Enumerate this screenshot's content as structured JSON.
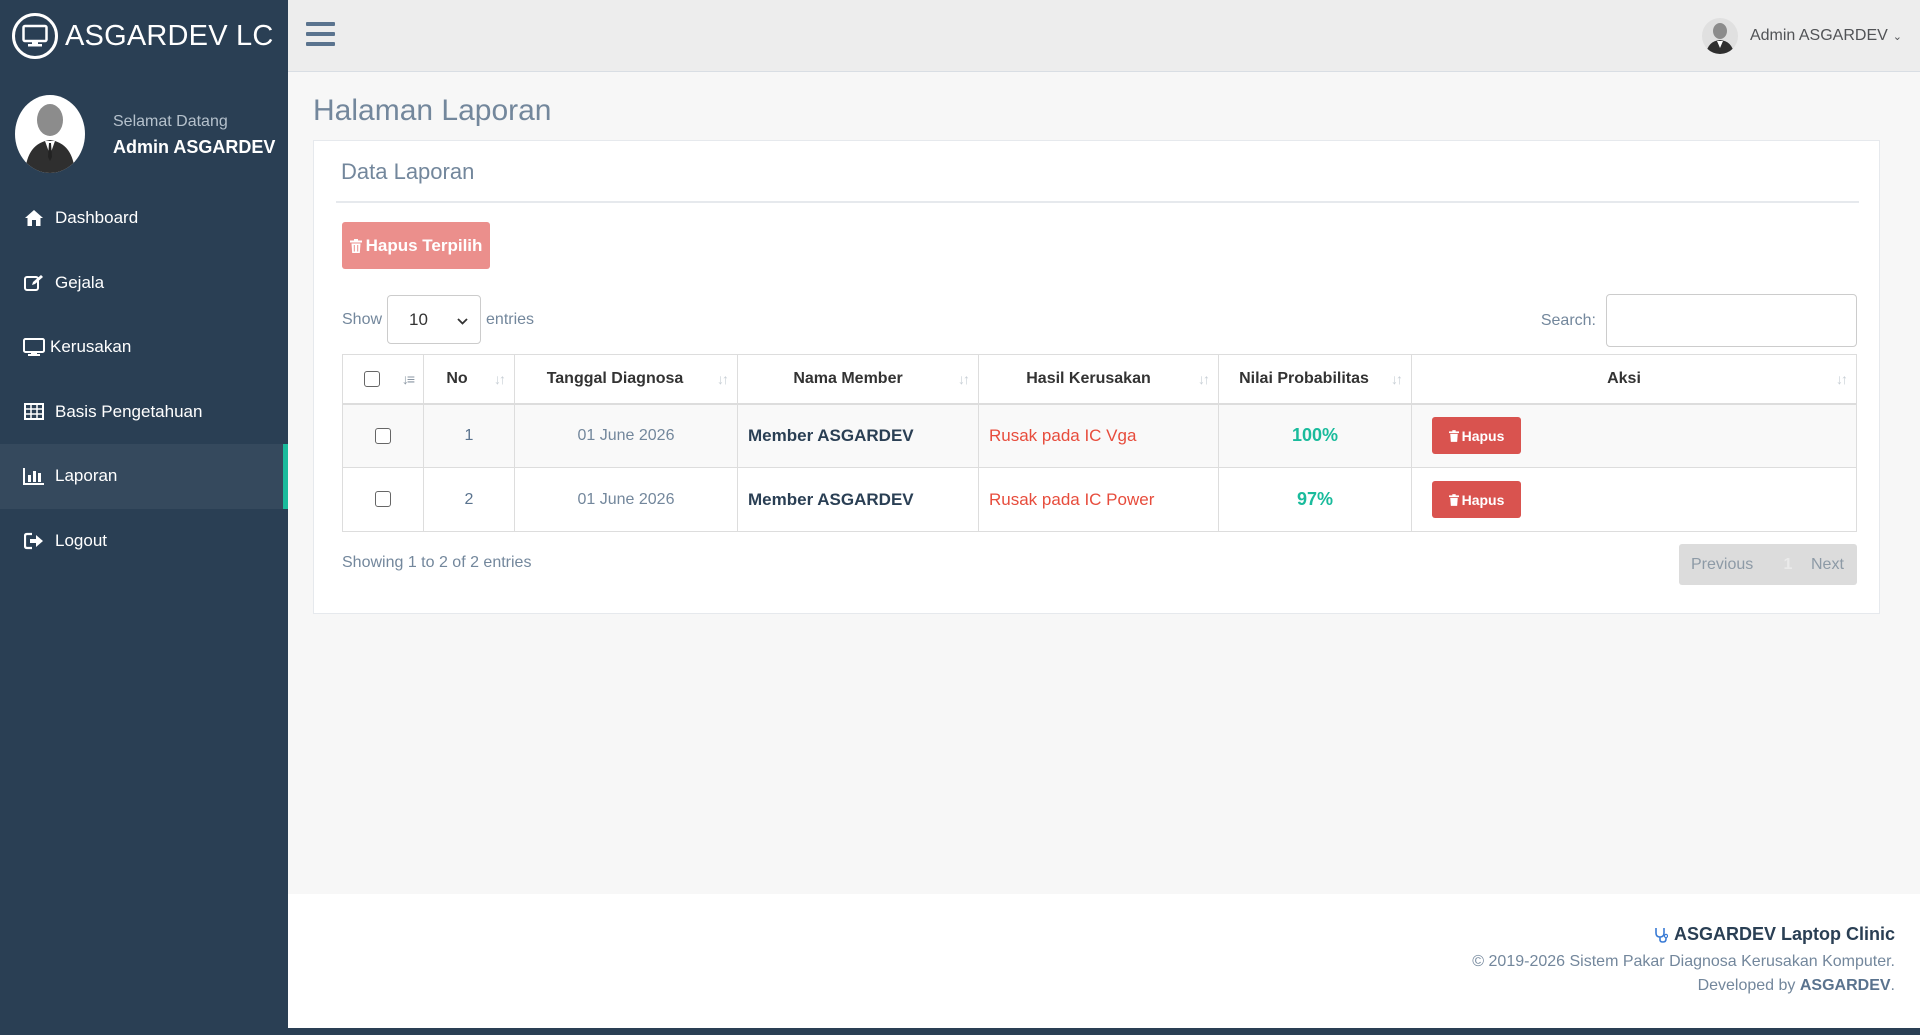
{
  "brand": {
    "title": "ASGARDEV LC",
    "logo_icon": "monitor-icon"
  },
  "profile": {
    "welcome": "Selamat Datang",
    "name": "Admin ASGARDEV"
  },
  "menu": [
    {
      "label": "Dashboard",
      "icon": "home-icon"
    },
    {
      "label": "Gejala",
      "icon": "edit-icon"
    },
    {
      "label": "Kerusakan",
      "icon": "monitor-icon"
    },
    {
      "label": "Basis Pengetahuan",
      "icon": "table-icon"
    },
    {
      "label": "Laporan",
      "icon": "bar-chart-icon",
      "active": true
    },
    {
      "label": "Logout",
      "icon": "sign-out-icon"
    }
  ],
  "topbar": {
    "user": "Admin ASGARDEV"
  },
  "page": {
    "title": "Halaman Laporan"
  },
  "panel": {
    "title": "Data Laporan",
    "delete_selected": "Hapus Terpilih",
    "show": "Show",
    "entries_value": "10",
    "entries": "entries",
    "search_label": "Search:",
    "search_value": ""
  },
  "table": {
    "headers": [
      "No",
      "Tanggal Diagnosa",
      "Nama Member",
      "Hasil Kerusakan",
      "Nilai Probabilitas",
      "Aksi"
    ],
    "rows": [
      {
        "no": "1",
        "date": "01 June 2026",
        "member": "Member ASGARDEV",
        "hasil": "Rusak pada IC Vga",
        "prob": "100%",
        "action": "Hapus"
      },
      {
        "no": "2",
        "date": "01 June 2026",
        "member": "Member ASGARDEV",
        "hasil": "Rusak pada IC Power",
        "prob": "97%",
        "action": "Hapus"
      }
    ]
  },
  "info": "Showing 1 to 2 of 2 entries",
  "pager": {
    "previous": "Previous",
    "current": "1",
    "next": "Next"
  },
  "footer": {
    "title": "ASGARDEV Laptop Clinic",
    "copyright": "© 2019-2026 Sistem Pakar Diagnosa Kerusakan Komputer.",
    "developed_by": "Developed by",
    "developer": "ASGARDEV",
    "developer_suffix": "."
  },
  "colors": {
    "sidebar": "#2a3f54",
    "accent": "#1abb9c",
    "danger": "#d9534f",
    "danger_light": "#eb8f8c"
  }
}
